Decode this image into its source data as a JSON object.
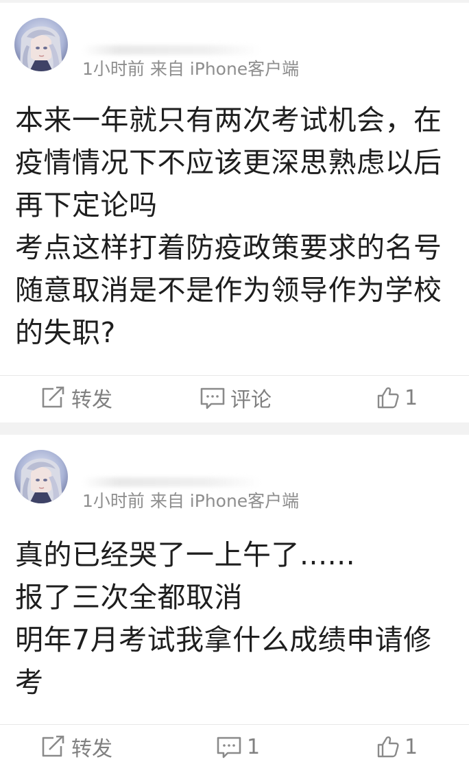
{
  "posts": [
    {
      "meta": "1小时前 来自 iPhone客户端",
      "lines": [
        "本来一年就只有两次考试机会，在",
        "疫情情况下不应该更深思熟虑以后",
        "再下定论吗",
        "考点这样打着防疫政策要求的名号",
        "随意取消是不是作为领导作为学校",
        "的失职?"
      ],
      "actions": {
        "repost_label": "转发",
        "comment_label": "评论",
        "like_count": "1"
      }
    },
    {
      "meta": "1小时前 来自 iPhone客户端",
      "lines": [
        "真的已经哭了一上午了......",
        "报了三次全都取消",
        "明年7月考试我拿什么成绩申请修",
        "考"
      ],
      "actions": {
        "repost_label": "转发",
        "comment_label": "1",
        "like_count": "1"
      }
    }
  ],
  "icons": {
    "repost": "repost-icon",
    "comment": "comment-icon",
    "like": "thumbs-up-icon"
  },
  "colors": {
    "background": "#f2f2f2",
    "card": "#ffffff",
    "text": "#1e1e1e",
    "meta": "#8e8e8e",
    "action": "#808080"
  }
}
